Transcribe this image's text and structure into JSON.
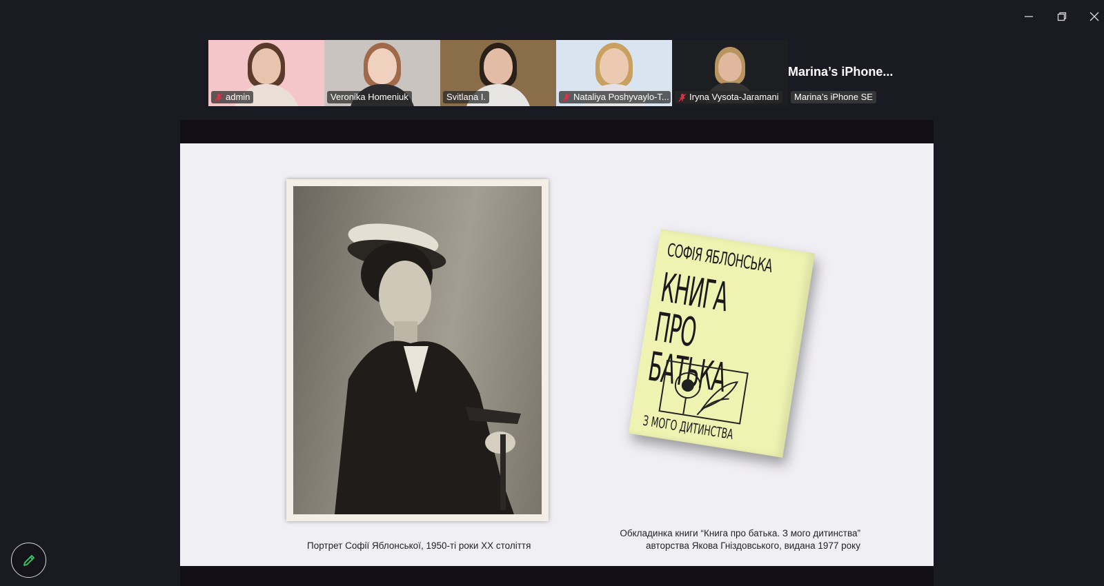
{
  "window": {
    "controls": [
      "minimize-icon",
      "restore-icon",
      "close-icon"
    ]
  },
  "participants": [
    {
      "name": "admin",
      "muted": true,
      "active": false,
      "bg": "#f4c6c9",
      "hair": "#5a3a2a",
      "skin": "#e8c3ae",
      "shirt": "#eaded7"
    },
    {
      "name": "Veronika Homeniuk",
      "muted": false,
      "active": false,
      "bg": "#c9c4bf",
      "hair": "#a06a4a",
      "skin": "#f0d0be",
      "shirt": "#2b2b30"
    },
    {
      "name": "Svitlana I.",
      "muted": false,
      "active": true,
      "bg": "#8a6e4a",
      "hair": "#2a2018",
      "skin": "#e2bca4",
      "shirt": "#e8e6e4"
    },
    {
      "name": "Nataliya Poshyvaylo-T...",
      "muted": true,
      "active": false,
      "bg": "#d9e4f1",
      "hair": "#c8a060",
      "skin": "#eccab2",
      "shirt": "#e5e2e6"
    },
    {
      "name": "Iryna Vysota-Jaramani",
      "muted": true,
      "active": false,
      "bg": "#1d1e22",
      "hair": "#b89460",
      "skin": "#e0b89e",
      "shirt": "#333333"
    }
  ],
  "phone": {
    "title": "Marina’s  iPhone...",
    "tag": "Marina’s iPhone SE"
  },
  "slide": {
    "book": {
      "author": "СОФІЯ ЯБЛОНСЬКА",
      "title": "КНИГА\nПРО БАТЬКА",
      "subtitle": "З МОГО ДИТИНСТВА"
    },
    "caption_left": "Портрет Софії Яблонської, 1950-ті роки XX століття",
    "caption_right": "Обкладинка книги “Книга про батька. З мого дитинства”\nавторства Якова Гніздовського, видана 1977 року"
  },
  "colors": {
    "active_speaker": "#22c05a",
    "mic_muted": "#e0304a",
    "background": "#1a1a22"
  },
  "annotate_icon": "pencil-icon"
}
